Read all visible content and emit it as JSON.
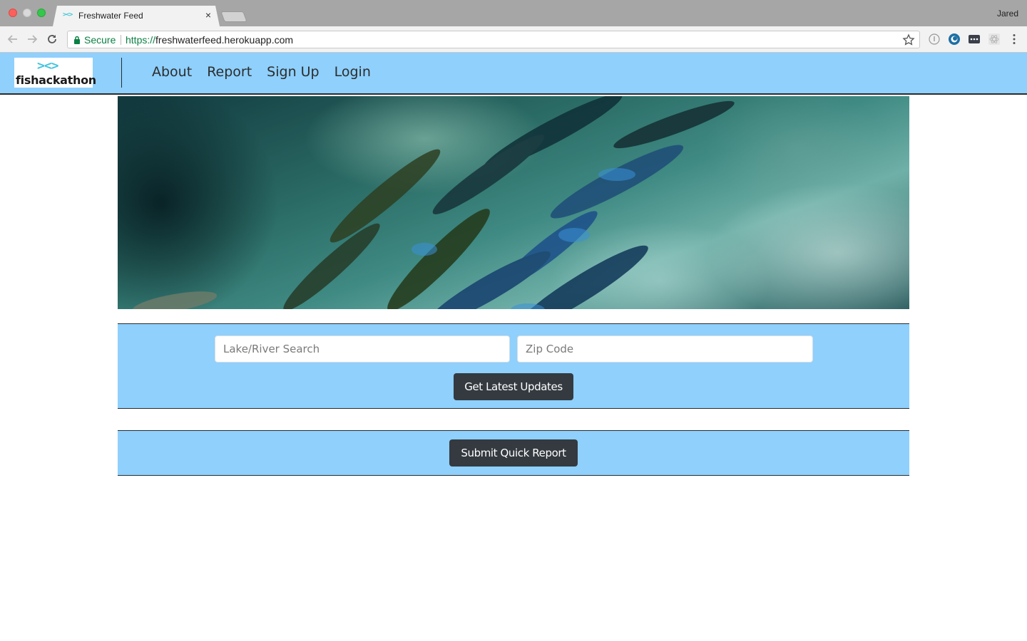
{
  "browser": {
    "tab_title": "Freshwater Feed",
    "tab_favicon": "><>",
    "tab_close": "×",
    "profile_name": "Jared",
    "secure_label": "Secure",
    "url_scheme": "https://",
    "url_host": "freshwaterfeed.herokuapp.com"
  },
  "site": {
    "logo_mark": "><>",
    "logo_text": "fishackathon",
    "nav": {
      "about": "About",
      "report": "Report",
      "signup": "Sign Up",
      "login": "Login"
    }
  },
  "search": {
    "lake_placeholder": "Lake/River Search",
    "zip_placeholder": "Zip Code",
    "button_label": "Get Latest Updates"
  },
  "report": {
    "button_label": "Submit Quick Report"
  },
  "colors": {
    "panel_blue": "#8fd0fd",
    "button_dark": "#343a40",
    "logo_accent": "#40c4dd"
  }
}
